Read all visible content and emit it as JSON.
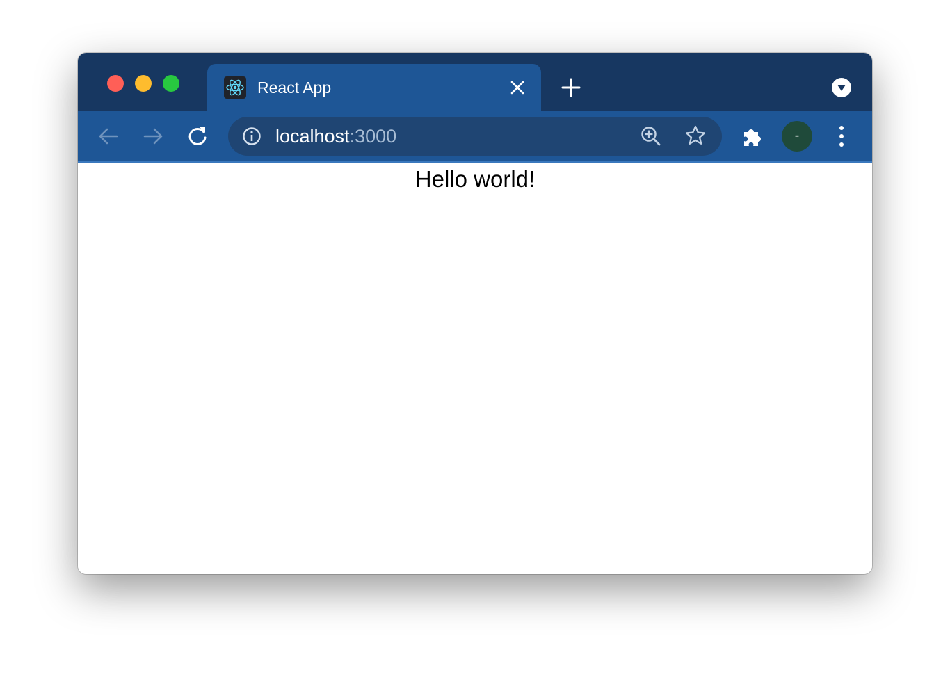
{
  "window": {
    "tab": {
      "title": "React App",
      "favicon": "react-logo-icon"
    },
    "toolbar": {
      "url_host": "localhost",
      "url_port": ":3000",
      "profile_initial": "-"
    },
    "icons": {
      "back": "arrow-left-icon",
      "forward": "arrow-right-icon",
      "reload": "reload-icon",
      "site_info": "info-icon",
      "zoom": "zoom-in-icon",
      "bookmark": "star-icon",
      "extensions": "puzzle-icon",
      "menu": "kebab-menu-icon",
      "new_tab": "plus-icon",
      "tab_search": "chevron-down-icon"
    },
    "colors": {
      "tabstrip": "#173761",
      "toolbar": "#1e5696",
      "omnibox": "#1f4573",
      "avatar": "#1f4a3a"
    }
  },
  "page": {
    "heading": "Hello world!"
  }
}
